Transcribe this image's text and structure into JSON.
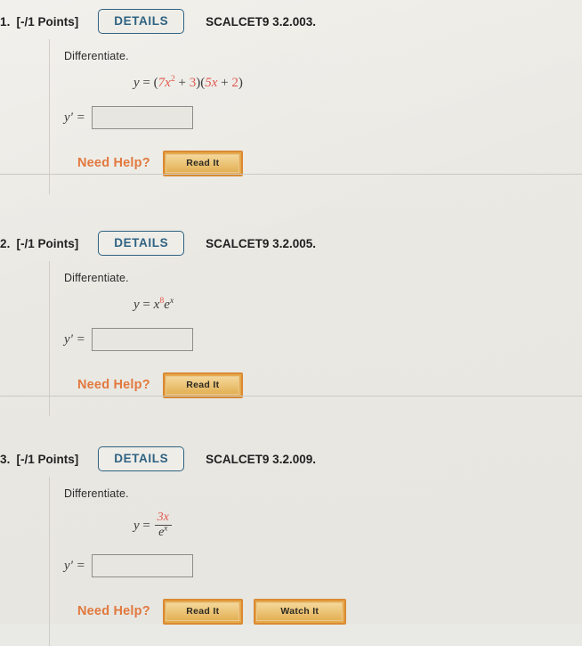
{
  "page": {
    "background_color": "#e9e9e5",
    "accent_blue": "#2f6282",
    "accent_orange": "#e2793f",
    "math_red": "#e1574f"
  },
  "questions": [
    {
      "number": "1.",
      "points": "[-/1 Points]",
      "details_label": "DETAILS",
      "code": "SCALCET9 3.2.003.",
      "prompt": "Differentiate.",
      "equation_plain": "y = (7x^2 + 3)(5x + 2)",
      "equation_parts": {
        "lhs": "y",
        "equals": "=",
        "open1": "(",
        "term1_coeff": "7x",
        "term1_exp": "2",
        "plus1": "+",
        "term2": "3",
        "close1": ")",
        "open2": "(",
        "term3": "5x",
        "plus2": "+",
        "term4": "2",
        "close2": ")"
      },
      "answer_label": "y' =",
      "answer_value": "",
      "answer_placeholder": "",
      "need_help_label": "Need Help?",
      "help_buttons": [
        "Read It"
      ]
    },
    {
      "number": "2.",
      "points": "[-/1 Points]",
      "details_label": "DETAILS",
      "code": "SCALCET9 3.2.005.",
      "prompt": "Differentiate.",
      "equation_plain": "y = x^8 e^x",
      "equation_parts": {
        "lhs": "y",
        "equals": "=",
        "base": "x",
        "exp": "8",
        "e": "e",
        "e_exp": "x"
      },
      "answer_label": "y' =",
      "answer_value": "",
      "answer_placeholder": "",
      "need_help_label": "Need Help?",
      "help_buttons": [
        "Read It"
      ]
    },
    {
      "number": "3.",
      "points": "[-/1 Points]",
      "details_label": "DETAILS",
      "code": "SCALCET9 3.2.009.",
      "prompt": "Differentiate.",
      "equation_plain": "y = 3x / e^x",
      "equation_parts": {
        "lhs": "y",
        "equals": "=",
        "numerator": "3x",
        "denominator_base": "e",
        "denominator_exp": "x"
      },
      "answer_label": "y' =",
      "answer_value": "",
      "answer_placeholder": "",
      "need_help_label": "Need Help?",
      "help_buttons": [
        "Read It",
        "Watch It"
      ]
    }
  ]
}
